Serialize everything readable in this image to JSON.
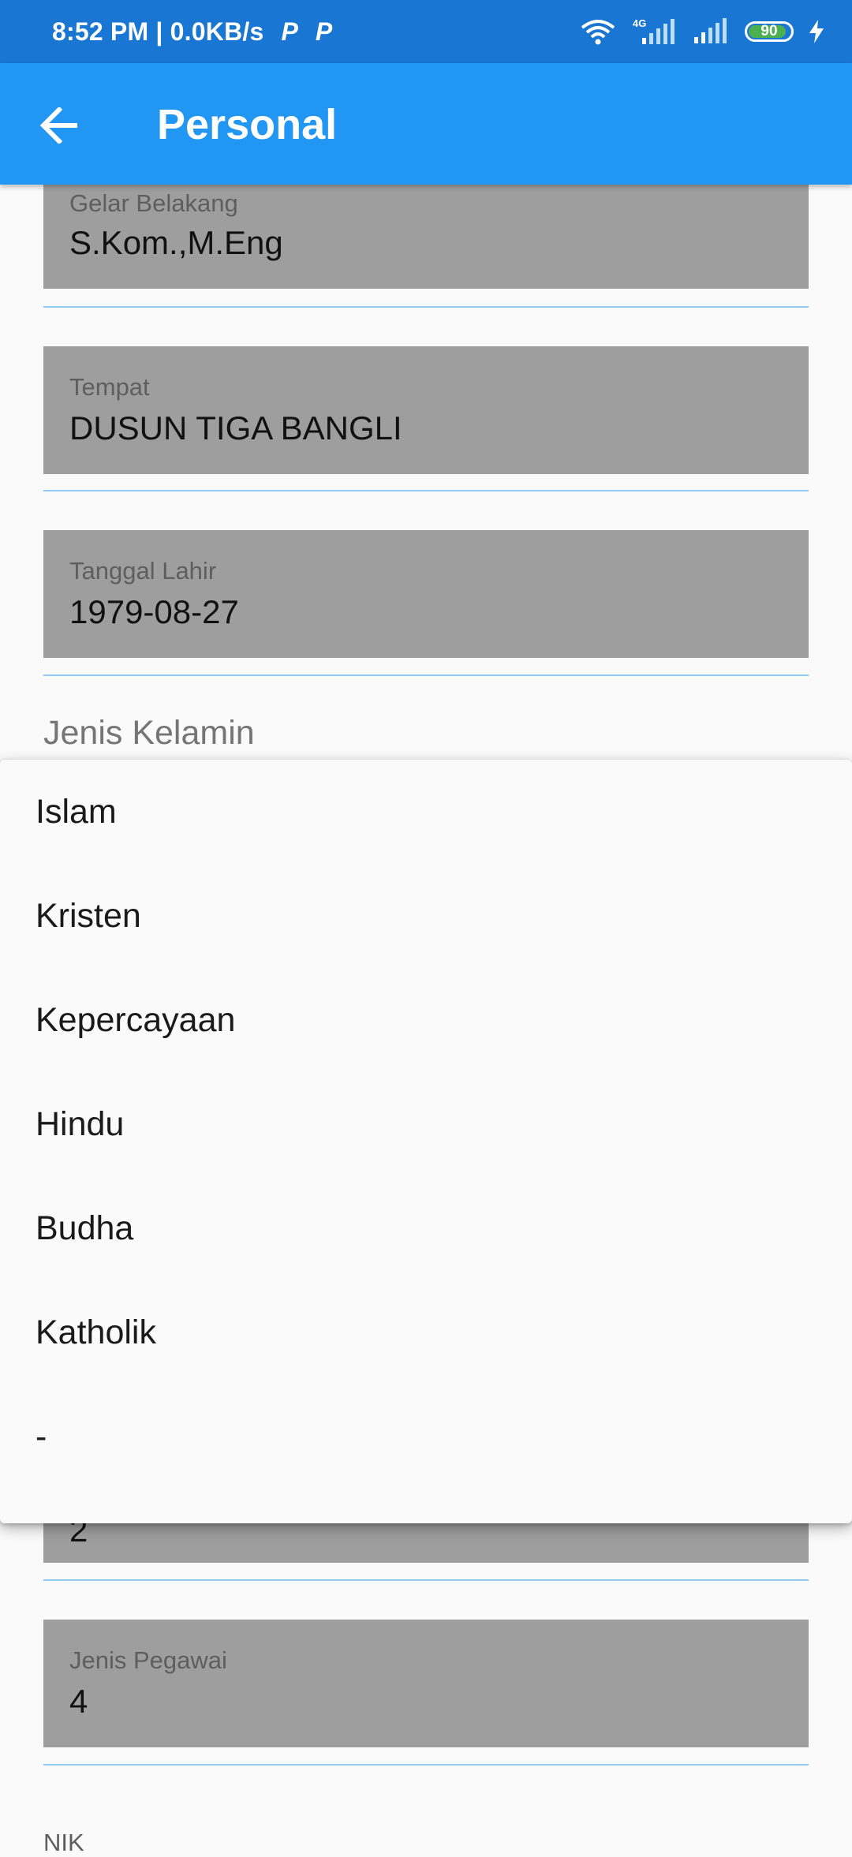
{
  "status_bar": {
    "time_speed": "8:52 PM | 0.0KB/s",
    "app_badge_1": "P",
    "app_badge_2": "P",
    "network_label": "4G",
    "battery_level": 90,
    "battery_text": "90"
  },
  "app_bar": {
    "title": "Personal",
    "back_icon": "arrow-left-icon"
  },
  "fields": {
    "gelar_belakang": {
      "label": "Gelar Belakang",
      "value": "S.Kom.,M.Eng"
    },
    "tempat": {
      "label": "Tempat",
      "value": "DUSUN TIGA BANGLI"
    },
    "tanggal_lahir": {
      "label": "Tanggal Lahir",
      "value": "1979-08-27"
    },
    "hidden_value": "2",
    "jenis_pegawai": {
      "label": "Jenis Pegawai",
      "value": "4"
    },
    "nik": {
      "label": "NIK"
    }
  },
  "jenis_kelamin_label": "Jenis Kelamin",
  "dropdown": {
    "options": [
      "Islam",
      "Kristen",
      "Kepercayaan",
      "Hindu",
      "Budha",
      "Katholik",
      "-"
    ]
  },
  "colors": {
    "status_bar": "#1976d2",
    "app_bar": "#2196f3",
    "field_bg": "#9e9e9e",
    "underline": "#90caf9",
    "battery": "#4caf50"
  }
}
